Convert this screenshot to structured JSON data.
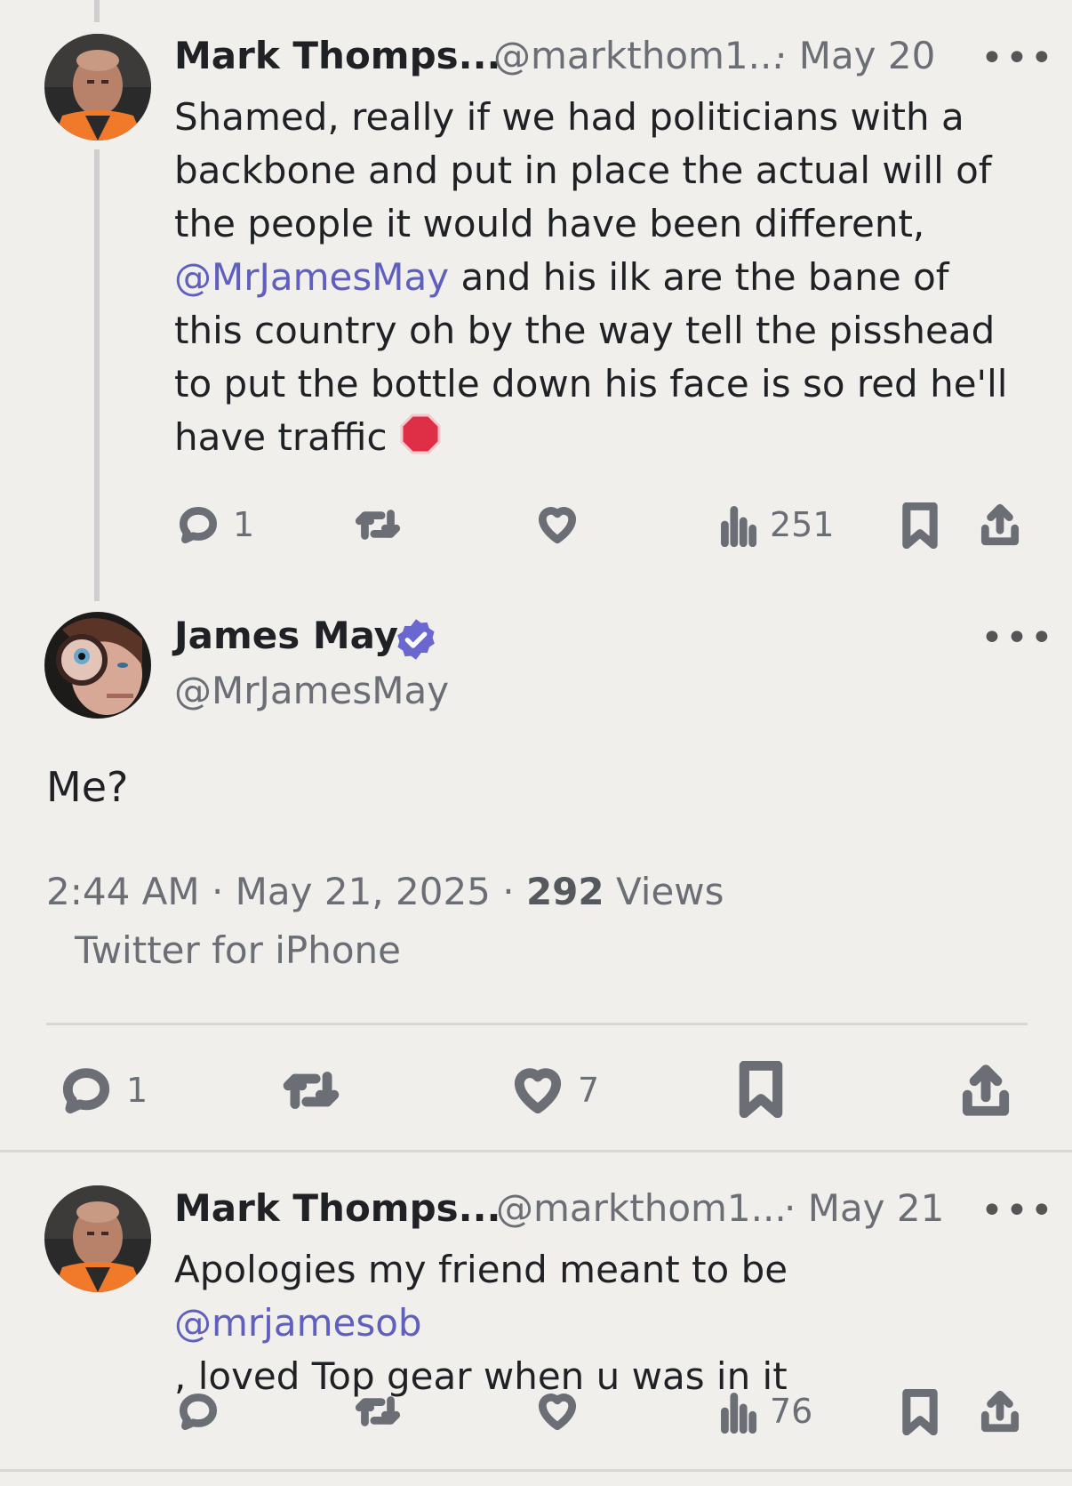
{
  "tweet1": {
    "name": "Mark Thomps...",
    "handle": "@markthom1...",
    "date": "· May 20",
    "more": "•••",
    "text_before": "Shamed, really if we had politicians with a backbone and put in place the actual will of the people it would have been different, ",
    "mention": "@MrJamesMay",
    "text_after": " and his ilk are the bane of this country oh by the way tell the pisshead to put the bottle down his face is so red he'll have traffic ",
    "emoji": "stop-sign-icon",
    "replies": "1",
    "views": "251"
  },
  "main_tweet": {
    "name": "James May",
    "verified": "verified-badge-icon",
    "handle": "@MrJamesMay",
    "more": "•••",
    "text": "Me?",
    "time": "2:44 AM · May 21, 2025 · ",
    "views_count": "292",
    "views_label": " Views",
    "source": "Twitter for iPhone",
    "replies": "1",
    "likes": "7"
  },
  "tweet3": {
    "name": "Mark Thomps...",
    "handle": "@markthom1...",
    "date": "· May 21",
    "more": "•••",
    "text_before": "Apologies my friend meant to be ",
    "mention": "@mrjamesob",
    "text_after": ", loved Top gear when u was in it",
    "views": "76"
  },
  "colors": {
    "background": "#f1efec",
    "mention": "#5e5fbf",
    "verified": "#6a67cf",
    "stop_sign": "#de2f47"
  }
}
